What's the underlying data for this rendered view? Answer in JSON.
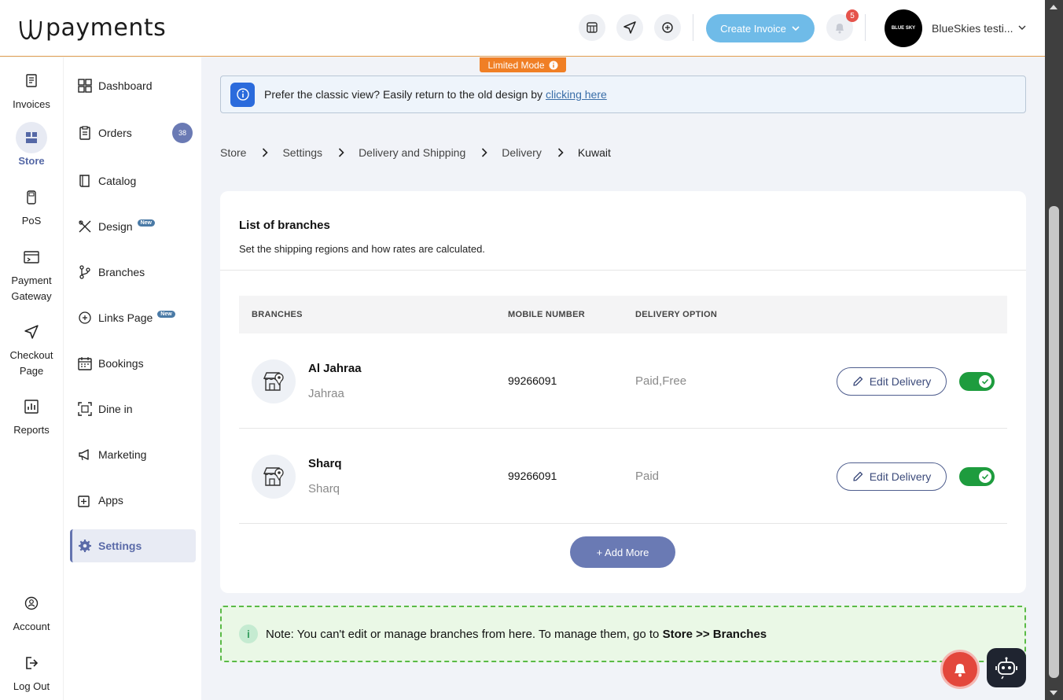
{
  "header": {
    "logo_text": "payments",
    "create_invoice_label": "Create Invoice",
    "notification_count": "5",
    "avatar_text": "BLUE SKY",
    "account_name": "BlueSkies testi..."
  },
  "rail": {
    "items": [
      {
        "label": "Invoices",
        "icon": "invoice-icon"
      },
      {
        "label": "Store",
        "icon": "store-icon"
      },
      {
        "label": "PoS",
        "icon": "pos-icon"
      },
      {
        "label": "Payment Gateway",
        "icon": "payment-gateway-icon"
      },
      {
        "label": "Checkout Page",
        "icon": "send-icon"
      },
      {
        "label": "Reports",
        "icon": "chart-icon"
      },
      {
        "label": "Account",
        "icon": "account-icon"
      },
      {
        "label": "Log Out",
        "icon": "logout-icon"
      }
    ]
  },
  "sidenav": {
    "items": [
      {
        "label": "Dashboard",
        "icon": "grid-icon"
      },
      {
        "label": "Orders",
        "icon": "clipboard-icon",
        "badge": "38"
      },
      {
        "label": "Catalog",
        "icon": "book-icon"
      },
      {
        "label": "Design",
        "icon": "design-icon",
        "badge": "New"
      },
      {
        "label": "Branches",
        "icon": "branch-icon"
      },
      {
        "label": "Links Page",
        "icon": "link-icon",
        "badge": "New"
      },
      {
        "label": "Bookings",
        "icon": "calendar-icon"
      },
      {
        "label": "Dine in",
        "icon": "scan-icon"
      },
      {
        "label": "Marketing",
        "icon": "megaphone-icon"
      },
      {
        "label": "Apps",
        "icon": "apps-icon"
      },
      {
        "label": "Settings",
        "icon": "gear-icon"
      }
    ]
  },
  "limited_mode": "Limited Mode",
  "classic_banner": {
    "text": "Prefer the classic view? Easily return to the old design by",
    "link": "clicking here"
  },
  "breadcrumb": [
    "Store",
    "Settings",
    "Delivery and Shipping",
    "Delivery",
    "Kuwait"
  ],
  "card": {
    "title": "List of branches",
    "subtitle": "Set the shipping regions and how rates are calculated.",
    "columns": [
      "BRANCHES",
      "MOBILE NUMBER",
      "DELIVERY OPTION"
    ],
    "rows": [
      {
        "name": "Al Jahraa",
        "area": "Jahraa",
        "mobile": "99266091",
        "option": "Paid,Free",
        "action": "Edit Delivery",
        "enabled": true
      },
      {
        "name": "Sharq",
        "area": "Sharq",
        "mobile": "99266091",
        "option": "Paid",
        "action": "Edit Delivery",
        "enabled": true
      }
    ],
    "add_more": "+ Add More"
  },
  "note": {
    "text": "Note: You can't edit or manage branches from here. To manage them, go to",
    "bold": "Store >> Branches"
  },
  "colors": {
    "accent": "#6a7ab4",
    "create_button": "#6fbbe8",
    "limited_mode": "#f07f25",
    "toggle_on": "#1e9c3e"
  }
}
